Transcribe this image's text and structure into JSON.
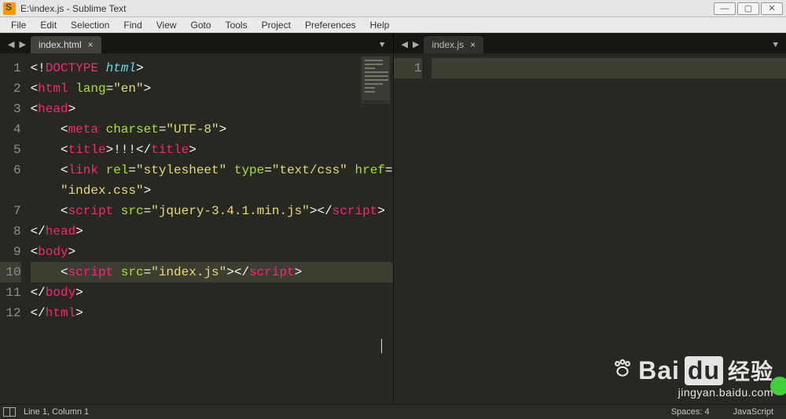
{
  "window": {
    "title": "E:\\index.js - Sublime Text"
  },
  "menu": {
    "items": [
      "File",
      "Edit",
      "Selection",
      "Find",
      "View",
      "Goto",
      "Tools",
      "Project",
      "Preferences",
      "Help"
    ]
  },
  "panes": {
    "left": {
      "tab": {
        "label": "index.html",
        "hasClose": true
      },
      "lines": [
        1,
        2,
        3,
        4,
        5,
        6,
        7,
        8,
        9,
        10,
        11,
        12
      ],
      "activeLine": 10,
      "code": {
        "l1": {
          "a": "<!",
          "b": "DOCTYPE ",
          "c": "html",
          "d": ">"
        },
        "l2": {
          "a": "<",
          "b": "html ",
          "c": "lang",
          "d": "=",
          "e": "\"en\"",
          "f": ">"
        },
        "l3": {
          "a": "<",
          "b": "head",
          "c": ">"
        },
        "l4": {
          "ind": "    ",
          "a": "<",
          "b": "meta ",
          "c": "charset",
          "d": "=",
          "e": "\"UTF-8\"",
          "f": ">"
        },
        "l5": {
          "ind": "    ",
          "a": "<",
          "b": "title",
          "c": ">",
          "d": "!!!",
          "e": "</",
          "f": "title",
          "g": ">"
        },
        "l6": {
          "ind": "    ",
          "a": "<",
          "b": "link ",
          "c": "rel",
          "d": "=",
          "e": "\"stylesheet\" ",
          "f": "type",
          "g": "=",
          "h": "\"text/css\" ",
          "i": "href",
          "j": "="
        },
        "l6b": {
          "ind": "    ",
          "a": "\"index.css\"",
          "b": ">"
        },
        "l7": {
          "ind": "    ",
          "a": "<",
          "b": "script ",
          "c": "src",
          "d": "=",
          "e": "\"jquery-3.4.1.min.js\"",
          "f": ">",
          "g": "</",
          "h": "script",
          "i": ">"
        },
        "l8": {
          "a": "</",
          "b": "head",
          "c": ">"
        },
        "l9": {
          "a": "<",
          "b": "body",
          "c": ">"
        },
        "l10": {
          "ind": "    ",
          "a": "<",
          "b": "script ",
          "c": "src",
          "d": "=",
          "e": "\"index.js\"",
          "f": ">",
          "g": "</",
          "h": "script",
          "i": ">"
        },
        "l11": {
          "a": "</",
          "b": "body",
          "c": ">"
        },
        "l12": {
          "a": "</",
          "b": "html",
          "c": ">"
        }
      }
    },
    "right": {
      "tab": {
        "label": "index.js",
        "hasClose": true
      },
      "lines": [
        1
      ],
      "activeLine": 1
    }
  },
  "statusbar": {
    "position": "Line 1, Column 1",
    "spaces": "Spaces: 4",
    "language": "JavaScript"
  },
  "watermark": {
    "logo1": "Bai",
    "logo2": "du",
    "logo3": "经验",
    "url": "jingyan.baidu.com"
  }
}
